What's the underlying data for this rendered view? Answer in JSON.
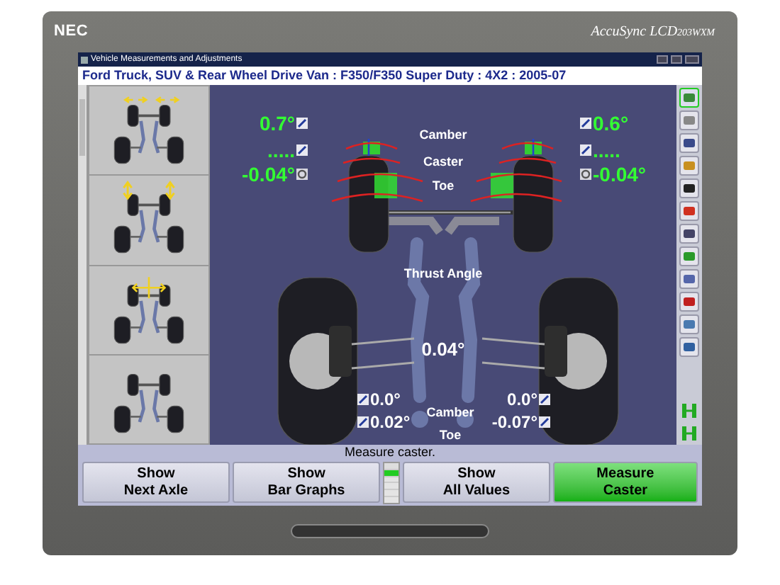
{
  "monitor": {
    "brand": "NEC",
    "model": "AccuSync LCD",
    "model_suffix": "203WXM"
  },
  "window": {
    "title": "Vehicle Measurements and Adjustments"
  },
  "vehicle_header": "Ford Truck, SUV & Rear Wheel Drive Van : F350/F350 Super Duty : 4X2 : 2005-07",
  "thumbnails": [
    {
      "kind": "toe"
    },
    {
      "kind": "camber"
    },
    {
      "kind": "cross"
    },
    {
      "kind": "plain"
    }
  ],
  "front_axle": {
    "labels": [
      "Camber",
      "Caster",
      "Toe"
    ],
    "left": [
      {
        "value": "0.7°",
        "kind": "adjust",
        "in_spec": true
      },
      {
        "value": ".....",
        "kind": "adjust",
        "in_spec": true
      },
      {
        "value": "-0.04°",
        "kind": "gauge",
        "in_spec": true
      }
    ],
    "right": [
      {
        "value": "0.6°",
        "kind": "adjust",
        "in_spec": true
      },
      {
        "value": ".....",
        "kind": "adjust",
        "in_spec": true
      },
      {
        "value": "-0.04°",
        "kind": "gauge",
        "in_spec": true
      }
    ]
  },
  "rear_axle": {
    "thrust_label": "Thrust Angle",
    "thrust_value": "0.04°",
    "labels": [
      "Camber",
      "Toe"
    ],
    "left": [
      {
        "value": "0.0°",
        "kind": "adjust",
        "in_spec": false
      },
      {
        "value": "0.02°",
        "kind": "adjust",
        "in_spec": false
      }
    ],
    "right": [
      {
        "value": "0.0°",
        "kind": "adjust",
        "in_spec": false
      },
      {
        "value": "-0.07°",
        "kind": "adjust",
        "in_spec": false
      }
    ]
  },
  "status": "Measure caster.",
  "buttons": [
    {
      "label": "Show\nNext Axle",
      "kind": "normal"
    },
    {
      "label": "Show\nBar Graphs",
      "kind": "normal"
    },
    {
      "label": "Show\nAll Values",
      "kind": "normal"
    },
    {
      "label": "Measure\nCaster",
      "kind": "primary"
    }
  ]
}
